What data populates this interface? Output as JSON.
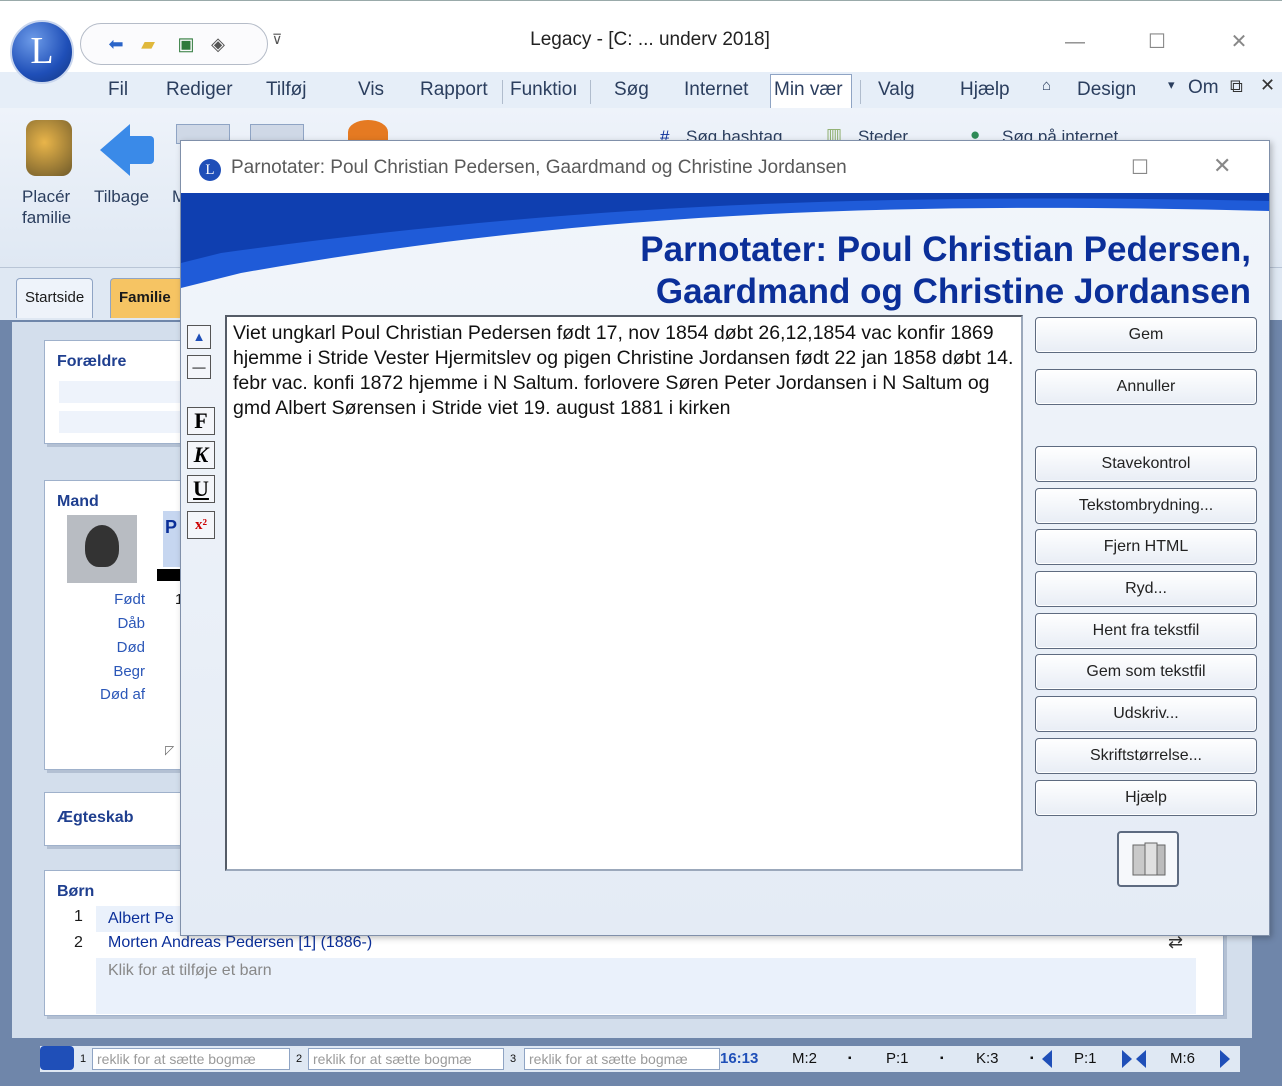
{
  "window": {
    "title": "Legacy - [C: ... underv 2018]",
    "minimize": "—",
    "maximize": "☐",
    "close": "✕"
  },
  "logo_letter": "L",
  "menu": {
    "items": [
      "Fil",
      "Rediger",
      "Tilføj",
      "Vis",
      "Rapport",
      "Funktioı",
      "Søg",
      "Internet",
      "Min vær",
      "Valg",
      "Hjælp"
    ],
    "design": "Design",
    "om": "Om"
  },
  "ribbon": {
    "place_family": "Placér\nfamilie",
    "back": "Tilbage",
    "truncated_m": "M",
    "hashtag_search": "Søg hashtag",
    "places": "Steder",
    "internet_search": "Søg på internet"
  },
  "tabs": {
    "start": "Startside",
    "family": "Familie"
  },
  "family": {
    "parents_title": "Forældre",
    "husband_title": "Mand",
    "husband_name_initial": "P",
    "born_label": "Født",
    "born_value": "1",
    "baptism_label": "Dåb",
    "death_label": "Død",
    "burial_label": "Begr",
    "cause_label": "Død af",
    "marriage_title": "Ægteskab",
    "children_title": "Børn",
    "children": [
      {
        "num": "1",
        "name": "Albert Pe"
      },
      {
        "num": "2",
        "name": "Morten Andreas Pedersen [1] (1886-)"
      }
    ],
    "add_child": "Klik for at tilføje et barn"
  },
  "dialog": {
    "title": "Parnotater: Poul Christian Pedersen, Gaardmand og Christine Jordansen",
    "heading_line1": "Parnotater: Poul Christian Pedersen,",
    "heading_line2": "Gaardmand og Christine Jordansen",
    "note_text": "Viet ungkarl Poul Christian Pedersen født 17, nov 1854 døbt 26,12,1854 vac konfir 1869 hjemme i Stride Vester Hjermitslev og pigen Christine Jordansen født 22 jan 1858 døbt 14. febr vac. konfi 1872 hjemme i N Saltum. forlovere Søren Peter Jordansen i N Saltum og gmd Albert Sørensen i Stride viet 19. august 1881 i kirken",
    "format_buttons": {
      "up": "▲",
      "minus": "—",
      "bold": "F",
      "italic": "K",
      "underline": "U",
      "superscript": "x²"
    },
    "buttons": {
      "save": "Gem",
      "cancel": "Annuller",
      "spellcheck": "Stavekontrol",
      "wordwrap": "Tekstombrydning...",
      "remove_html": "Fjern HTML",
      "clean": "Ryd...",
      "load_textfile": "Hent fra tekstfil",
      "save_textfile": "Gem som tekstfil",
      "print": "Udskriv...",
      "font_size": "Skriftstørrelse...",
      "help": "Hjælp"
    }
  },
  "statusbar": {
    "bookmarks": [
      {
        "num": "1",
        "text": "reklik for at sætte bogmæ"
      },
      {
        "num": "2",
        "text": "reklik for at sætte bogmæ"
      },
      {
        "num": "3",
        "text": "reklik for at sætte bogmæ"
      }
    ],
    "time": "16:13",
    "m": "M:2",
    "p": "P:1",
    "k": "K:3",
    "p2": "P:1",
    "m2": "M:6"
  },
  "colors": {
    "accent": "#0b2f99",
    "label_blue": "#2b57b8",
    "tab_family": "#f6c463"
  }
}
